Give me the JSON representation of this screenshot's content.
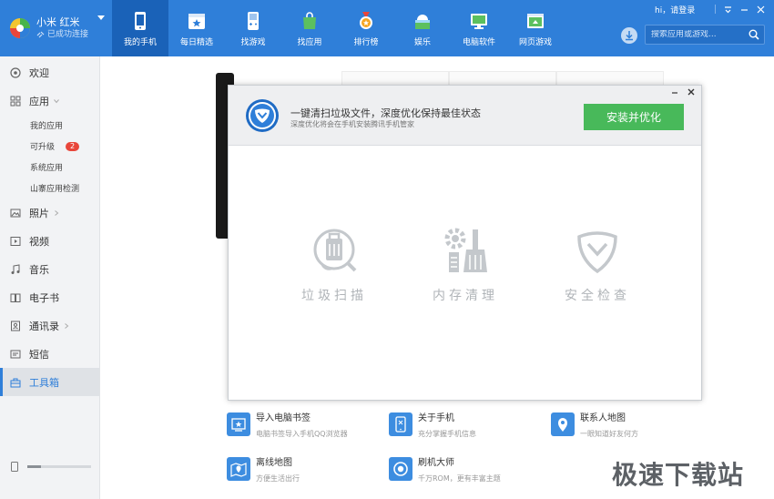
{
  "device": {
    "name": "小米 红米",
    "status": "已成功连接"
  },
  "nav": [
    {
      "label": "我的手机",
      "icon": "phone-icon",
      "active": true
    },
    {
      "label": "每日精选",
      "icon": "calendar-star-icon"
    },
    {
      "label": "找游戏",
      "icon": "gamepad-icon"
    },
    {
      "label": "找应用",
      "icon": "shopping-bag-icon"
    },
    {
      "label": "排行榜",
      "icon": "medal-icon"
    },
    {
      "label": "娱乐",
      "icon": "cloud-house-icon"
    },
    {
      "label": "电脑软件",
      "icon": "monitor-icon"
    },
    {
      "label": "网页游戏",
      "icon": "web-game-icon"
    }
  ],
  "header": {
    "login_text": "hi，请登录",
    "search_placeholder": "搜索应用或游戏..."
  },
  "sidebar": {
    "welcome": "欢迎",
    "apps": "应用",
    "sub": {
      "my_apps": "我的应用",
      "upgradable": "可升级",
      "upgradable_badge": "2",
      "system_apps": "系统应用",
      "copycat_check": "山寨应用检测"
    },
    "photos": "照片",
    "video": "视频",
    "music": "音乐",
    "ebook": "电子书",
    "contacts": "通讯录",
    "sms": "短信",
    "toolbox": "工具箱",
    "storage_fraction": 0.22
  },
  "tools": [
    {
      "name": "导入电脑书签",
      "desc": "电脑书签导入手机QQ浏览器",
      "icon": "bookmark-import-icon"
    },
    {
      "name": "关于手机",
      "desc": "充分掌握手机信息",
      "icon": "phone-info-icon"
    },
    {
      "name": "联系人地图",
      "desc": "一眼知道好友何方",
      "icon": "contact-map-icon"
    },
    {
      "name": "离线地图",
      "desc": "方便生活出行",
      "icon": "offline-map-icon"
    },
    {
      "name": "刷机大师",
      "desc": "千万ROM，更有丰富主题",
      "icon": "flash-master-icon"
    }
  ],
  "dialog": {
    "title": "一键清扫垃圾文件，深度优化保持最佳状态",
    "subtitle": "深度优化将会在手机安装腾讯手机管家",
    "install_button": "安装并优化",
    "features": [
      {
        "label": "垃圾扫描",
        "icon": "trash-scan-icon"
      },
      {
        "label": "内存清理",
        "icon": "memory-clean-icon"
      },
      {
        "label": "安全检查",
        "icon": "security-check-icon"
      }
    ]
  },
  "watermark": "极速下载站",
  "colors": {
    "header_blue": "#2f7fd9",
    "active_nav": "#1a62b8",
    "install_green": "#48b95a",
    "badge_red": "#e8463a"
  }
}
